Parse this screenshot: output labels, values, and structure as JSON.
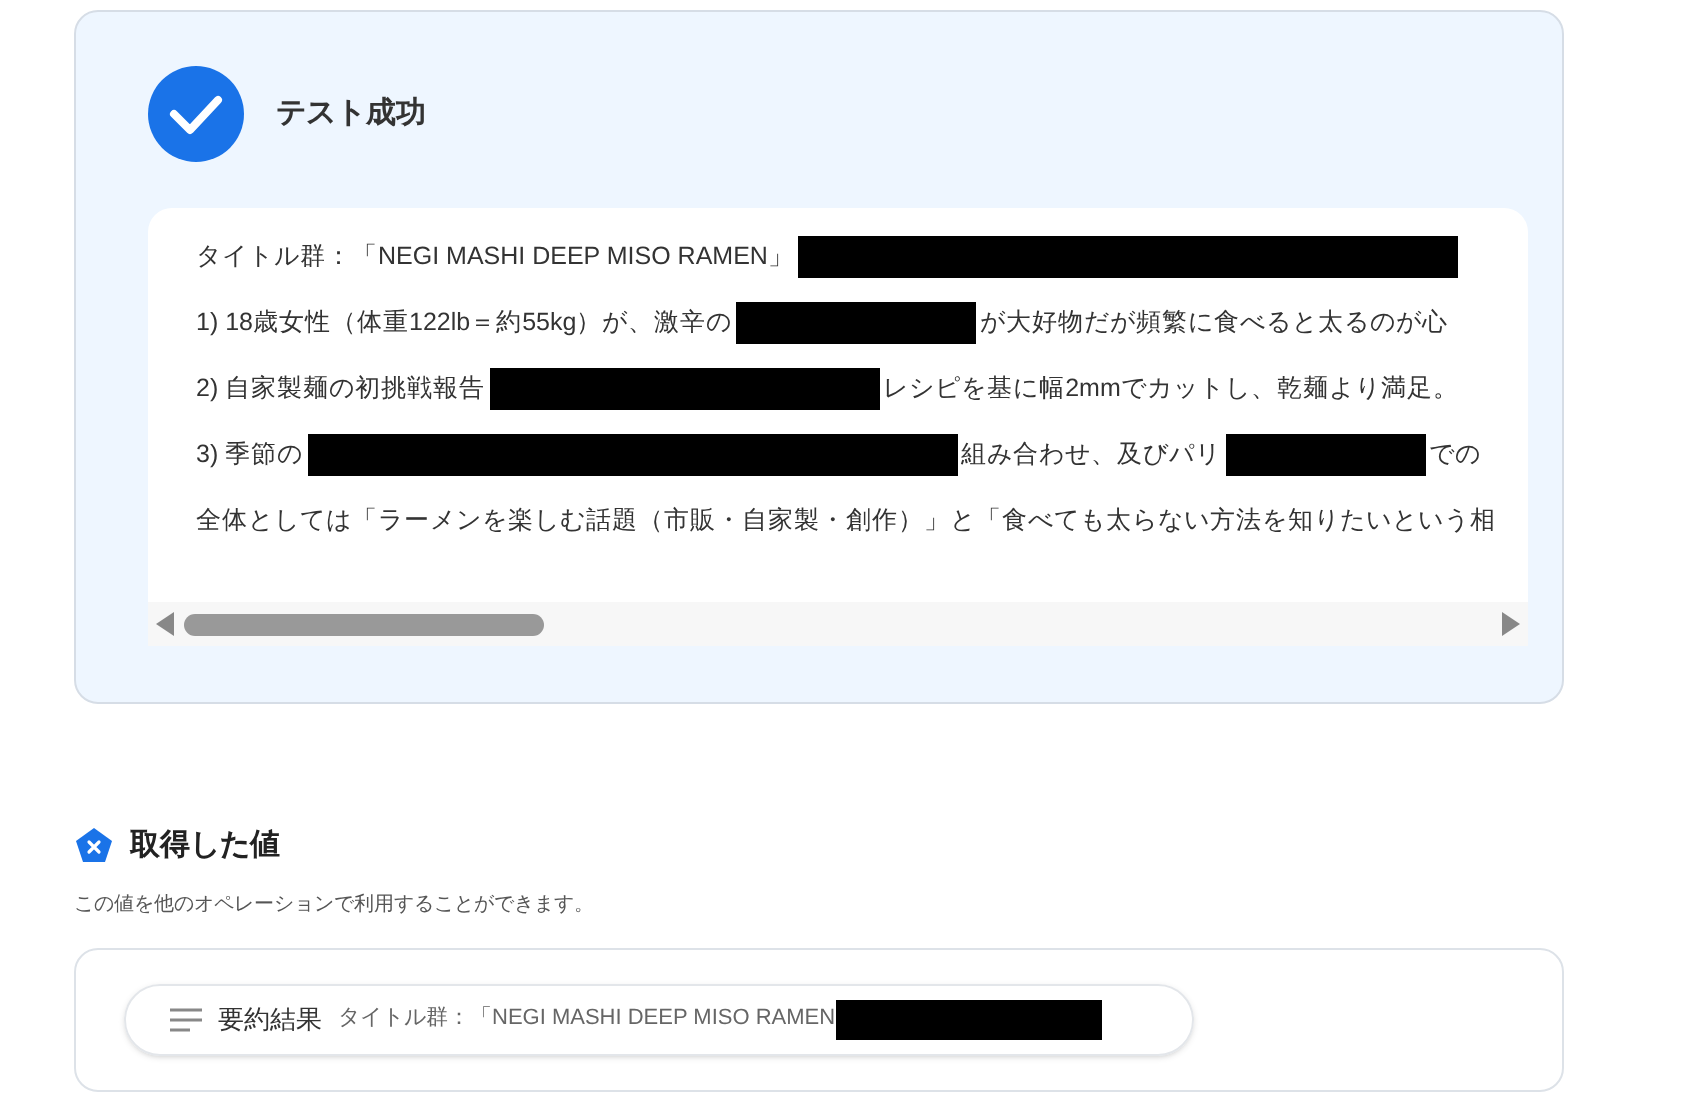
{
  "result": {
    "title": "テスト成功",
    "lines": [
      [
        {
          "kind": "text",
          "text": "タイトル群：「NEGI MASHI DEEP MISO RAMEN」"
        },
        {
          "kind": "redaction"
        }
      ],
      [
        {
          "kind": "text",
          "text": "1) 18歳女性（体重122lb＝約55kg）が、激辛の"
        },
        {
          "kind": "redaction"
        },
        {
          "kind": "text",
          "text": "が大好物だが頻繁に食べると太るのが心"
        }
      ],
      [
        {
          "kind": "text",
          "text": "2) 自家製麺の初挑戦報告"
        },
        {
          "kind": "redaction"
        },
        {
          "kind": "text",
          "text": "レシピを基に幅2mmでカットし、乾麺より満足。"
        }
      ],
      [
        {
          "kind": "text",
          "text": "3) 季節の"
        },
        {
          "kind": "redaction"
        },
        {
          "kind": "text",
          "text": "組み合わせ、及びパリ"
        },
        {
          "kind": "redaction"
        },
        {
          "kind": "text",
          "text": "での"
        }
      ],
      [
        {
          "kind": "text",
          "text": "全体としては「ラーメンを楽しむ話題（市販・自家製・創作）」と「食べても太らない方法を知りたいという相"
        }
      ]
    ]
  },
  "values": {
    "title": "取得した値",
    "description": "この値を他のオペレーションで利用することができます。",
    "items": [
      {
        "label": "要約結果",
        "value": "タイトル群：「NEGI MASHI DEEP MISO RAMEN"
      }
    ]
  }
}
